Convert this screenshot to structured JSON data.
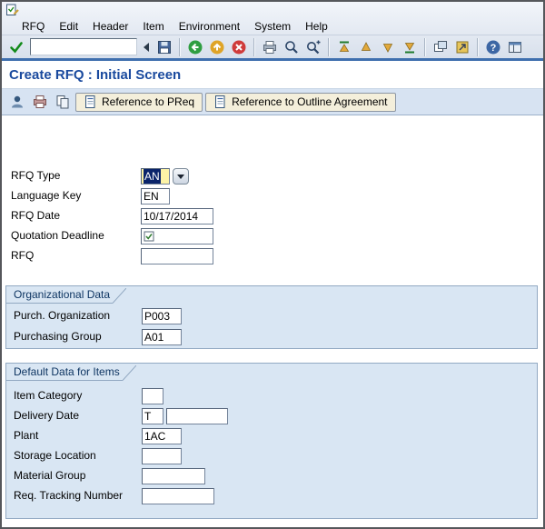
{
  "title": "Create RFQ : Initial Screen",
  "menu": {
    "items": [
      "RFQ",
      "Edit",
      "Header",
      "Item",
      "Environment",
      "System",
      "Help"
    ]
  },
  "toolbar": {
    "command_value": ""
  },
  "icons": {
    "help_glyph": "?"
  },
  "app_toolbar": {
    "buttons": [
      {
        "label": "Reference to PReq"
      },
      {
        "label": "Reference to Outline Agreement"
      }
    ]
  },
  "fields": {
    "rfq_type": {
      "label": "RFQ Type",
      "value": "AN"
    },
    "language_key": {
      "label": "Language Key",
      "value": "EN"
    },
    "rfq_date": {
      "label": "RFQ Date",
      "value": "10/17/2014"
    },
    "quotation_deadline": {
      "label": "Quotation Deadline",
      "value": ""
    },
    "rfq": {
      "label": "RFQ",
      "value": ""
    }
  },
  "org_data": {
    "title": "Organizational Data",
    "purch_org": {
      "label": "Purch. Organization",
      "value": "P003"
    },
    "purch_group": {
      "label": "Purchasing Group",
      "value": "A01"
    }
  },
  "default_data": {
    "title": "Default Data for Items",
    "item_category": {
      "label": "Item Category",
      "value": ""
    },
    "delivery_date": {
      "label": "Delivery Date",
      "value": "T",
      "value2": ""
    },
    "plant": {
      "label": "Plant",
      "value": "1AC"
    },
    "storage_location": {
      "label": "Storage Location",
      "value": ""
    },
    "material_group": {
      "label": "Material Group",
      "value": ""
    },
    "req_tracking": {
      "label": "Req. Tracking Number",
      "value": ""
    }
  }
}
